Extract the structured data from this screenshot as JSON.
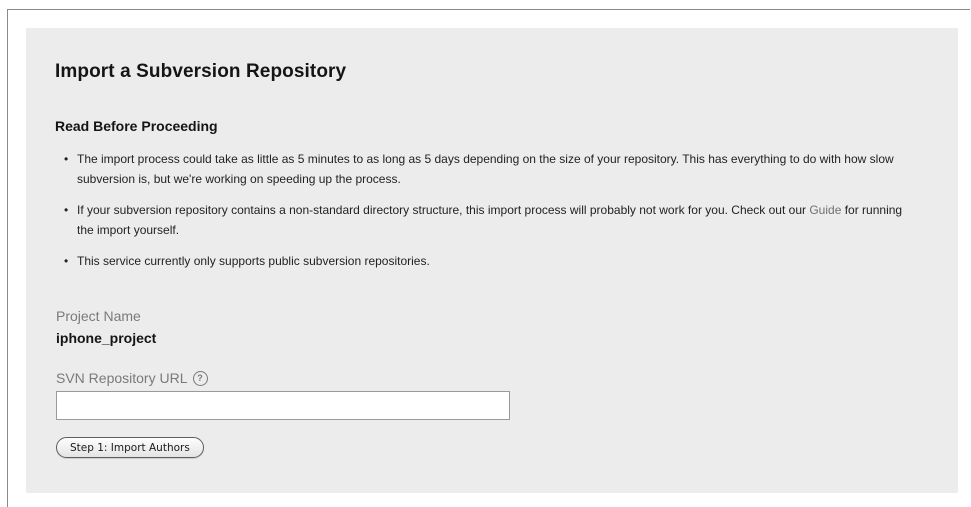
{
  "page": {
    "title": "Import a Subversion Repository",
    "section_heading": "Read Before Proceeding"
  },
  "notes": [
    {
      "before": "The import process could take as little as 5 minutes to as long as 5 days depending on the size of your repository. This has everything to do with how slow subversion is, but we're working on speeding up the process.",
      "link": "",
      "after": ""
    },
    {
      "before": "If your subversion repository contains a non-standard directory structure, this import process will probably not work for you. Check out our",
      "link": "Guide",
      "after": "for running the import yourself."
    },
    {
      "before": "This service currently only supports public subversion repositories.",
      "link": "",
      "after": ""
    }
  ],
  "form": {
    "project_name_label": "Project Name",
    "project_name_value": "iphone_project",
    "svn_url_label": "SVN Repository URL",
    "svn_url_value": "",
    "help_icon_glyph": "?",
    "import_button_label": "Step 1: Import Authors"
  },
  "icons": {
    "help": "help-circle-icon"
  },
  "colors": {
    "panel_background": "#ececec",
    "link": "#707070",
    "label": "#7a7a7a"
  }
}
